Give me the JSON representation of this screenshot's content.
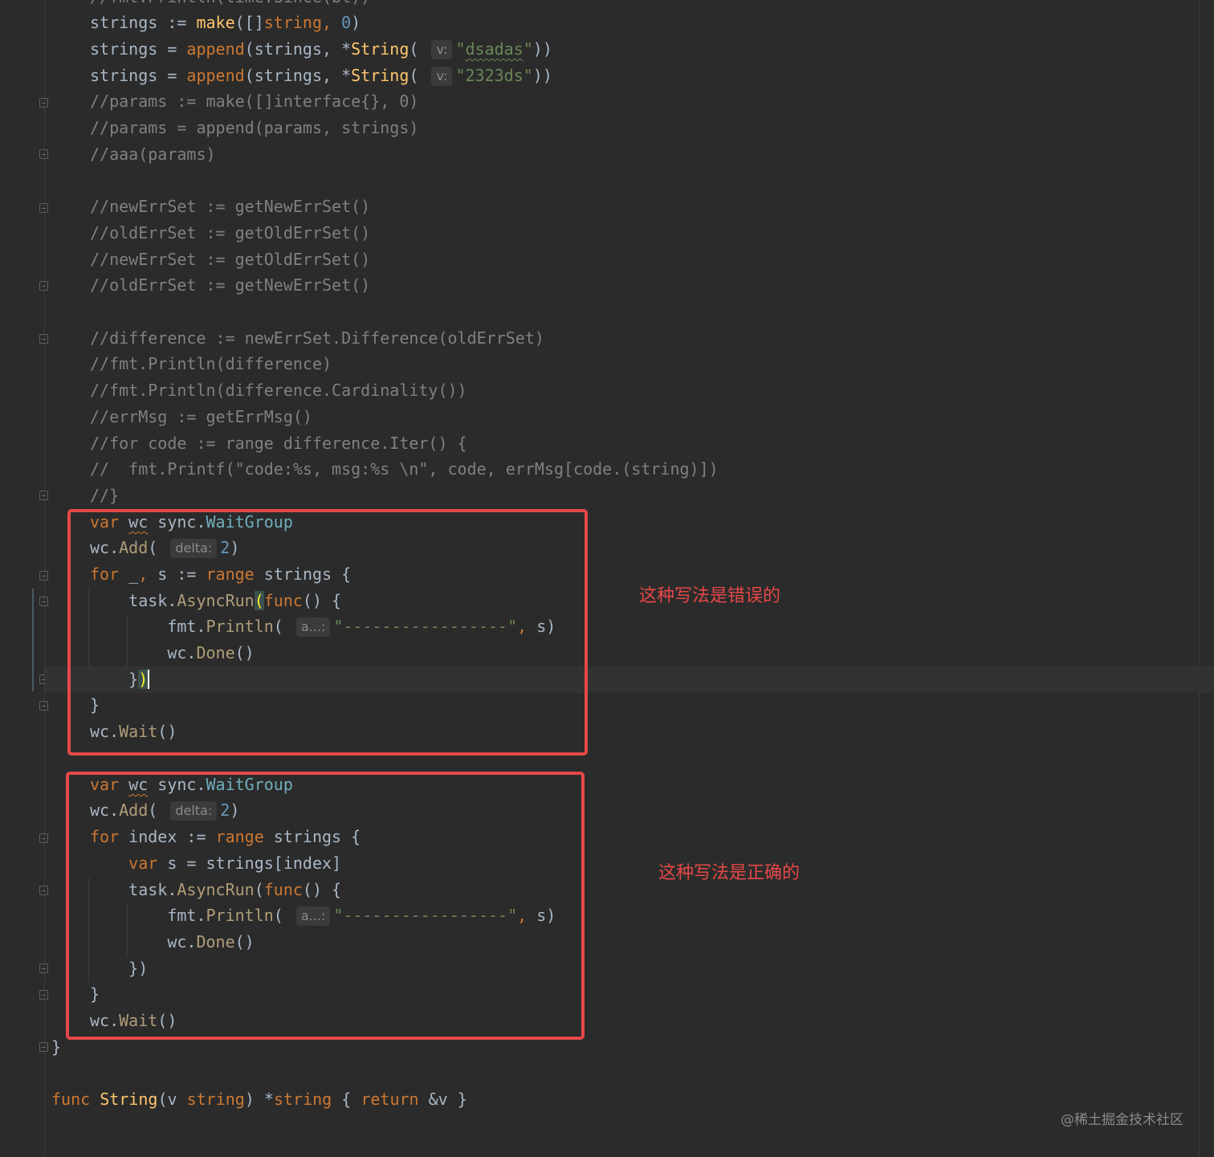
{
  "editor": {
    "language": "Go",
    "theme_colors": {
      "background": "#2b2b2b",
      "keyword": "#cc7832",
      "function": "#ffc66d",
      "string": "#6a8759",
      "number": "#6897bb",
      "comment": "#808080",
      "plain": "#a9b7c6",
      "annotation_red": "#e54848"
    },
    "lines": {
      "l0": "//fmt.Println(time.Since(bt))",
      "l1a": "strings := ",
      "l1b": "make",
      "l1c": "([]",
      "l1d": "string",
      "l1e": ", ",
      "l1f": "0",
      "l1g": ")",
      "l2a": "strings = ",
      "l2b": "append",
      "l2c": "(strings, *",
      "l2d": "String",
      "l2e": "( ",
      "l2hint": "v:",
      "l2f": "\"",
      "l2g": "dsadas",
      "l2h": "\"",
      "l2i": "))",
      "l3a": "strings = ",
      "l3b": "append",
      "l3c": "(strings, *",
      "l3d": "String",
      "l3e": "( ",
      "l3hint": "v:",
      "l3f": "\"2323ds\"",
      "l3g": "))",
      "l4": "//params := make([]interface{}, 0)",
      "l5": "//params = append(params, strings)",
      "l6": "//aaa(params)",
      "l8": "//newErrSet := getNewErrSet()",
      "l9": "//oldErrSet := getOldErrSet()",
      "l10": "//newErrSet := getOldErrSet()",
      "l11": "//oldErrSet := getNewErrSet()",
      "l13": "//difference := newErrSet.Difference(oldErrSet)",
      "l14": "//fmt.Println(difference)",
      "l15": "//fmt.Println(difference.Cardinality())",
      "l16": "//errMsg := getErrMsg()",
      "l17": "//for code := range difference.Iter() {",
      "l18": "//  fmt.Printf(\"code:%s, msg:%s \\n\", code, errMsg[code.(string)])",
      "l19": "//}",
      "w1a": "var",
      "w1b": " ",
      "w1c": "wc",
      "w1d": " sync.",
      "w1e": "WaitGroup",
      "w2a": "wc.",
      "w2b": "Add",
      "w2c": "( ",
      "w2hint": "delta:",
      "w2d": "2",
      "w2e": ")",
      "w3a": "for",
      "w3b": " _",
      "w3c": ",",
      "w3d": " s := ",
      "w3e": "range",
      "w3f": " strings {",
      "w4a": "    task.",
      "w4b": "AsyncRun",
      "w4c": "(",
      "w4d": "func",
      "w4e": "() {",
      "w5a": "        fmt.",
      "w5b": "Println",
      "w5c": "( ",
      "w5hint": "a...:",
      "w5d": "\"-----------------\"",
      "w5e": ",",
      "w5f": " s)",
      "w6a": "        wc.",
      "w6b": "Done",
      "w6c": "()",
      "w7a": "    }",
      "w7b": ")",
      "w8": "}",
      "w9a": "wc.",
      "w9b": "Wait",
      "w9c": "()",
      "c1a": "var",
      "c1b": " ",
      "c1c": "wc",
      "c1d": " sync.",
      "c1e": "WaitGroup",
      "c2a": "wc.",
      "c2b": "Add",
      "c2c": "( ",
      "c2hint": "delta:",
      "c2d": "2",
      "c2e": ")",
      "c3a": "for",
      "c3b": " index := ",
      "c3c": "range",
      "c3d": " strings {",
      "c4a": "    ",
      "c4b": "var",
      "c4c": " s = strings[index]",
      "c5a": "    task.",
      "c5b": "AsyncRun",
      "c5c": "(",
      "c5d": "func",
      "c5e": "() {",
      "c6a": "        fmt.",
      "c6b": "Println",
      "c6c": "( ",
      "c6hint": "a...:",
      "c6d": "\"-----------------\"",
      "c6e": ",",
      "c6f": " s)",
      "c7a": "        wc.",
      "c7b": "Done",
      "c7c": "()",
      "c8": "    })",
      "c9": "}",
      "c10a": "wc.",
      "c10b": "Wait",
      "c10c": "()",
      "e1": "}",
      "f1a": "func",
      "f1b": " ",
      "f1c": "String",
      "f1d": "(v ",
      "f1e": "string",
      "f1f": ") *",
      "f1g": "string",
      "f1h": " { ",
      "f1i": "return",
      "f1j": " &v }"
    }
  },
  "annotations": {
    "wrong_label": "这种写法是错误的",
    "correct_label": "这种写法是正确的"
  },
  "watermark": "@稀土掘金技术社区"
}
